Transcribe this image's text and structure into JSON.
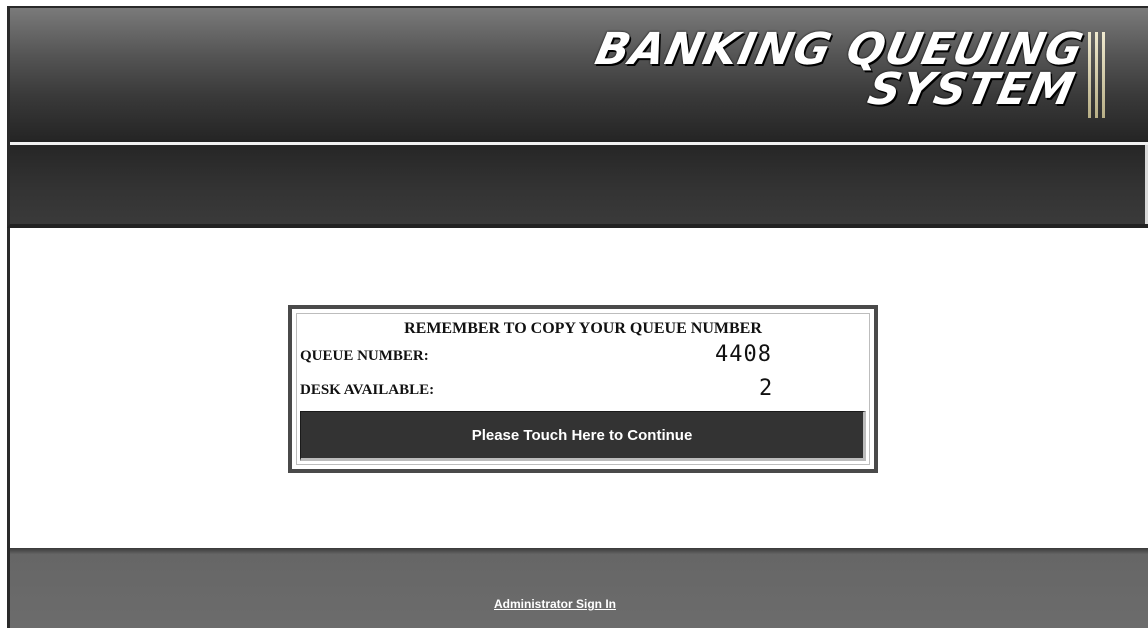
{
  "header": {
    "logo_line1": "BANKING QUEUING",
    "logo_line2": "SYSTEM"
  },
  "ticket": {
    "reminder": "REMEMBER TO COPY YOUR QUEUE NUMBER",
    "queue_label": "QUEUE NUMBER:",
    "queue_value": "4408",
    "desk_label": "DESK AVAILABLE:",
    "desk_value": "2",
    "continue_label": "Please Touch Here to Continue"
  },
  "footer": {
    "admin_link": "Administrator Sign In"
  },
  "colors": {
    "header_dark": "#2e2e2e",
    "button_bg": "#333333",
    "footer_bg": "#6c6c6c",
    "logo_bars": "#d8cfa6"
  }
}
